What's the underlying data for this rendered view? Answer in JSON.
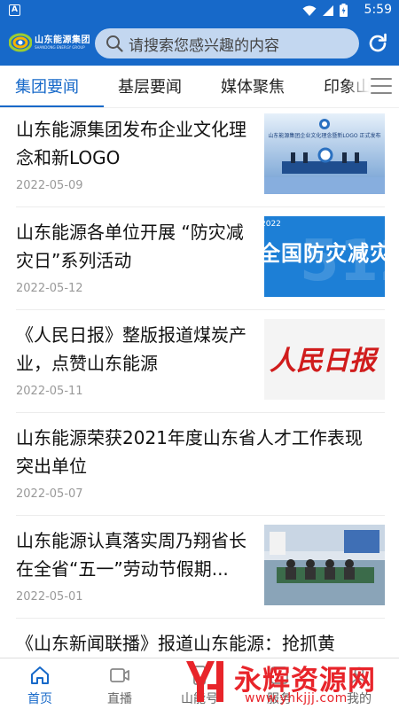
{
  "status_bar": {
    "time": "5:59",
    "notification_letter": "A"
  },
  "header": {
    "logo_cn": "山东能源集团",
    "logo_en": "SHANDONG ENERGY GROUP",
    "search_placeholder": "请搜索您感兴趣的内容"
  },
  "tabs": [
    {
      "label": "集团要闻",
      "active": true
    },
    {
      "label": "基层要闻",
      "active": false
    },
    {
      "label": "媒体聚焦",
      "active": false
    },
    {
      "label": "印象山",
      "active": false
    }
  ],
  "news": [
    {
      "title": "山东能源集团发布企业文化理念和新LOGO",
      "date": "2022-05-09",
      "thumb_text": "山东能源集团企业文化理念暨新LOGO 正式发布"
    },
    {
      "title": "山东能源各单位开展 “防灾减灾日”系列活动",
      "date": "2022-05-12",
      "thumb_text": "全国防灾减灾日",
      "thumb_year": "2022",
      "thumb_bg": "512"
    },
    {
      "title": "《人民日报》整版报道煤炭产业，点赞山东能源",
      "date": "2022-05-11",
      "thumb_text": "人民日报"
    },
    {
      "title": "山东能源荣获2021年度山东省人才工作表现突出单位",
      "date": "2022-05-07"
    },
    {
      "title": "山东能源认真落实周乃翔省长在全省“五一”劳动节假期...",
      "date": "2022-05-01"
    },
    {
      "title": "《山东新闻联播》报道山东能源：抢抓黄"
    }
  ],
  "bottom_nav": [
    {
      "label": "首页",
      "icon": "home-icon",
      "active": true
    },
    {
      "label": "直播",
      "icon": "video-icon",
      "active": false
    },
    {
      "label": "山能号",
      "icon": "phone-icon",
      "active": false
    },
    {
      "label": "服务",
      "icon": "service-icon",
      "active": false
    },
    {
      "label": "我的",
      "icon": "user-icon",
      "active": false
    }
  ],
  "watermark": {
    "name": "永辉资源网",
    "url": "www.yhkjjj.com"
  },
  "colors": {
    "primary": "#1769c9",
    "search_bg": "#c3d7f0",
    "watermark": "#e8242a"
  }
}
